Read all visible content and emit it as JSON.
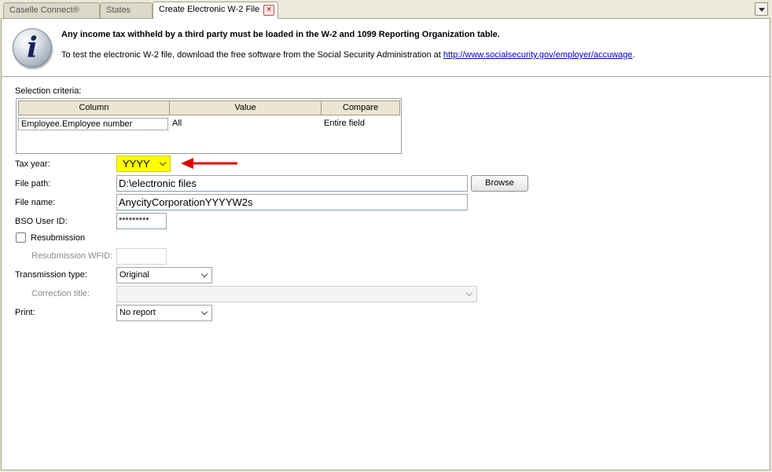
{
  "tabs": [
    {
      "label": "Caselle Connect®"
    },
    {
      "label": "States"
    },
    {
      "label": "Create Electronic W-2 File"
    }
  ],
  "info": {
    "title": "Any income tax withheld by a third party must be loaded in the W-2 and 1099 Reporting Organization table.",
    "text": "To test the electronic W-2 file, download the free software from the Social Security Administration at ",
    "link": "http://www.socialsecurity.gov/employer/accuwage",
    "text_end": "."
  },
  "selection": {
    "label": "Selection criteria:",
    "headers": [
      "Column",
      "Value",
      "Compare"
    ],
    "rows": [
      [
        "Employee.Employee number",
        "All",
        "Entire field"
      ]
    ]
  },
  "form": {
    "tax_year_label": "Tax year:",
    "tax_year_value": "YYYY",
    "file_path_label": "File path:",
    "file_path_value": "D:\\electronic files",
    "browse_label": "Browse",
    "file_name_label": "File name:",
    "file_name_value": "AnycityCorporationYYYYW2s",
    "bso_label": "BSO User ID:",
    "bso_value": "*********",
    "resubmission_label": "Resubmission",
    "resubmission_wfid_label": "Resubmission WFID:",
    "resubmission_wfid_value": "",
    "transmission_label": "Transmission type:",
    "transmission_value": "Original",
    "correction_label": "Correction title:",
    "correction_value": "",
    "print_label": "Print:",
    "print_value": "No report"
  },
  "colors": {
    "highlight": "#ffff00",
    "arrow": "#e00000",
    "link": "#0000cc"
  }
}
